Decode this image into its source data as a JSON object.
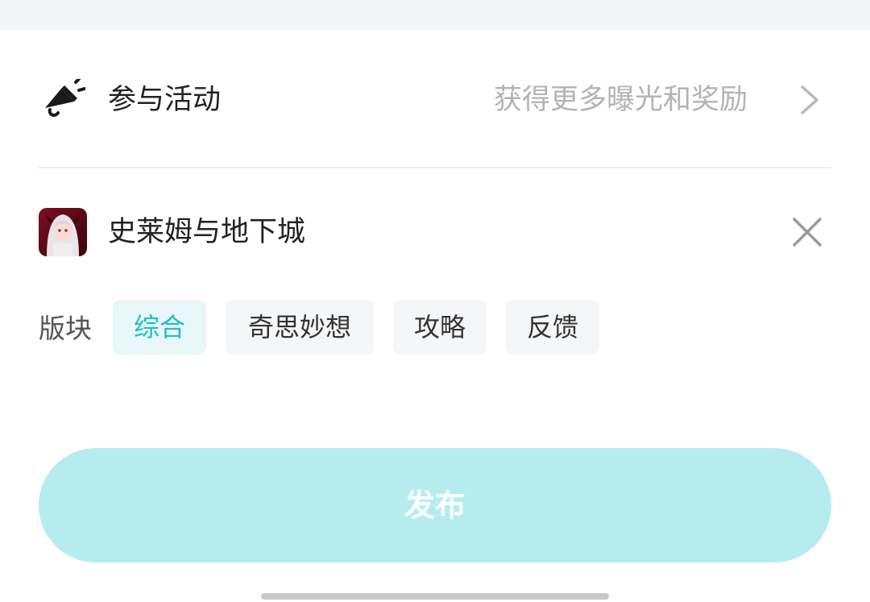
{
  "activity": {
    "title": "参与活动",
    "hint": "获得更多曝光和奖励",
    "icon": "megaphone-icon"
  },
  "game": {
    "title": "史莱姆与地下城",
    "icon": "game-avatar",
    "close_icon": "close-icon"
  },
  "board": {
    "label": "版块",
    "chips": [
      {
        "label": "综合",
        "selected": true
      },
      {
        "label": "奇思妙想",
        "selected": false
      },
      {
        "label": "攻略",
        "selected": false
      },
      {
        "label": "反馈",
        "selected": false
      }
    ]
  },
  "publish": {
    "label": "发布"
  },
  "colors": {
    "accent": "#23bfc8",
    "button_bg": "#b6ecee"
  }
}
